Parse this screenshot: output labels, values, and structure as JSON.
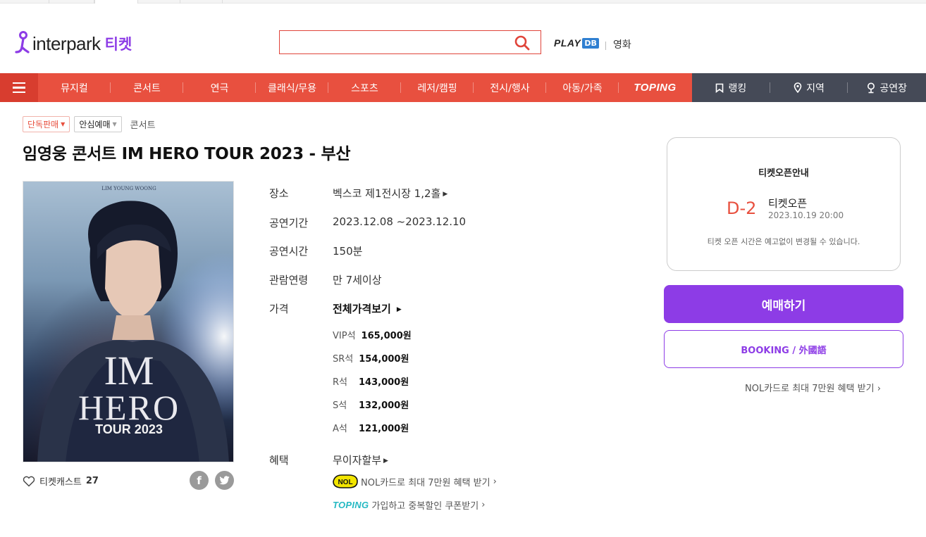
{
  "header": {
    "logo_text": "interpark",
    "logo_ticket": "티켓",
    "search_placeholder": "",
    "playdb_play": "PLAY",
    "playdb_db": "DB",
    "movie": "영화"
  },
  "nav": {
    "items": [
      "뮤지컬",
      "콘서트",
      "연극",
      "클래식/무용",
      "스포츠",
      "레저/캠핑",
      "전시/행사",
      "아동/가족",
      "TOPING"
    ],
    "right": [
      "랭킹",
      "지역",
      "공연장"
    ]
  },
  "tags": {
    "exclusive": "단독판매",
    "safe": "안심예매",
    "genre": "콘서트"
  },
  "title": "임영웅 콘서트 IM HERO TOUR 2023 - 부산",
  "poster": {
    "top_text": "LIM    YOUNG    WOONG",
    "line1": "IM",
    "line2": "HERO",
    "line3": "TOUR 2023"
  },
  "ticketcast": {
    "label": "티켓캐스트",
    "count": "27"
  },
  "info": {
    "venue_label": "장소",
    "venue": "벡스코 제1전시장 1,2홀",
    "period_label": "공연기간",
    "period": "2023.12.08 ~2023.12.10",
    "runtime_label": "공연시간",
    "runtime": "150분",
    "age_label": "관람연령",
    "age": "만 7세이상",
    "price_label": "가격",
    "price_all": "전체가격보기",
    "prices": [
      {
        "seat": "VIP석",
        "amount": "165,000원"
      },
      {
        "seat": "SR석",
        "amount": "154,000원"
      },
      {
        "seat": "R석",
        "amount": "143,000원"
      },
      {
        "seat": "S석",
        "amount": "132,000원"
      },
      {
        "seat": "A석",
        "amount": "121,000원"
      }
    ],
    "benefit_label": "혜택",
    "benefit": "무이자할부",
    "nol_promo": "NOL카드로 최대 7만원 혜택 받기",
    "nol_badge": "NOL",
    "toping_logo": "TOPING",
    "toping_promo": "가입하고 중복할인 쿠폰받기"
  },
  "open": {
    "title": "티켓오픈안내",
    "dday": "D-2",
    "label": "티켓오픈",
    "date": "2023.10.19 20:00",
    "note": "티켓 오픈 시간은 예고없이 변경될 수 있습니다."
  },
  "buttons": {
    "book": "예매하기",
    "foreign": "BOOKING / 外國語",
    "nolcard": "NOL카드로 최대 7만원 혜택 받기"
  },
  "colors": {
    "brand_purple": "#8d3ce6",
    "nav_red": "#e8503f",
    "nav_dark": "#454a57"
  }
}
